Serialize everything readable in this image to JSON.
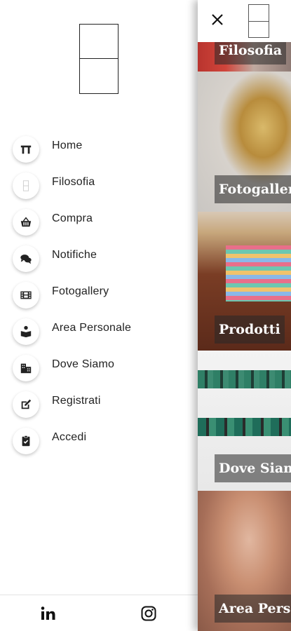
{
  "menu": {
    "items": [
      {
        "label": "Home",
        "icon": "home-icon"
      },
      {
        "label": "Filosofia",
        "icon": "logo-icon"
      },
      {
        "label": "Compra",
        "icon": "basket-icon"
      },
      {
        "label": "Notifiche",
        "icon": "chat-icon"
      },
      {
        "label": "Fotogallery",
        "icon": "film-icon"
      },
      {
        "label": "Area Personale",
        "icon": "reader-icon"
      },
      {
        "label": "Dove Siamo",
        "icon": "city-icon"
      },
      {
        "label": "Registrati",
        "icon": "edit-icon"
      },
      {
        "label": "Accedi",
        "icon": "clipboard-check-icon"
      }
    ]
  },
  "footer": {
    "social": [
      "linkedin-icon",
      "instagram-icon"
    ]
  },
  "panel": {
    "tiles": [
      {
        "label": "Filosofia"
      },
      {
        "label": "Fotogallery"
      },
      {
        "label": "Prodotti"
      },
      {
        "label": "Dove Siamo"
      },
      {
        "label": "Area Personale"
      }
    ]
  },
  "colors": {
    "icon": "#222222",
    "tile_label_bg": "rgba(40,40,40,0.55)",
    "tile_label_text": "#ffffff"
  }
}
